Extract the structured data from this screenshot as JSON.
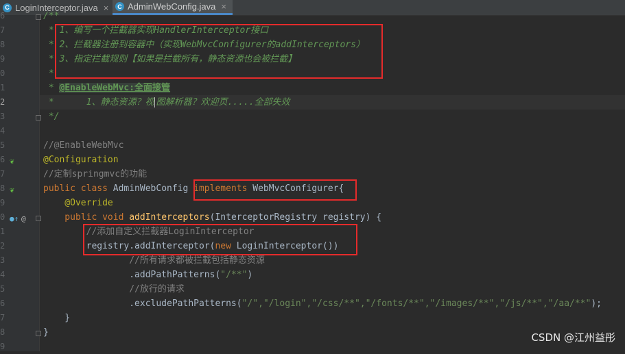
{
  "tabs": [
    {
      "label": "LoginInterceptor.java",
      "active": false
    },
    {
      "label": "AdminWebConfig.java",
      "active": true
    }
  ],
  "line_numbers": [
    "6",
    "7",
    "8",
    "9",
    "0",
    "1",
    "2",
    "3",
    "4",
    "5",
    "6",
    "7",
    "8",
    "9",
    "0",
    "1",
    "2",
    "3",
    "4",
    "5",
    "6",
    "7",
    "8",
    "9"
  ],
  "code": {
    "l0": "/**",
    "l1": " * 1、编写一个拦截器实现HandlerInterceptor接口",
    "l2": " * 2、拦截器注册到容器中（实现WebMvcConfigurer的addInterceptors）",
    "l3": " * 3、指定拦截规则【如果是拦截所有，静态资源也会被拦截】",
    "l4": " *",
    "l5_prefix": " * ",
    "l5_tag": "@EnableWebMvc:全面接管",
    "l6_a": " *      1、静态资源？视",
    "l6_b": "图解析器？欢迎页.....全部失效",
    "l7": " */",
    "l9": "//@EnableWebMvc",
    "l10": "@Configuration",
    "l11": "//定制springmvc的功能",
    "l12_kw": "public class ",
    "l12_name": "AdminWebConfig ",
    "l12_impl": "implements",
    "l12_iface": " WebMvcConfigurer{",
    "l13": "    @Override",
    "l14_kw": "    public void ",
    "l14_fn": "addInterceptors",
    "l14_rest": "(InterceptorRegistry registry) {",
    "l15": "        //添加自定义拦截器LoginInterceptor",
    "l16_a": "        registry.addInterceptor(",
    "l16_new": "new",
    "l16_b": " LoginInterceptor())",
    "l17": "                //所有请求都被拦截包括静态资源",
    "l18_a": "                .addPathPatterns(",
    "l18_s": "\"/**\"",
    "l18_b": ")",
    "l19": "                //放行的请求",
    "l20_a": "                .excludePathPatterns(",
    "l20_s": "\"/\",\"/login\",\"/css/**\",\"/fonts/**\",\"/images/**\",\"/js/**\",\"/aa/**\"",
    "l20_b": ");",
    "l21": "    }",
    "l22": "}"
  },
  "watermark": "CSDN @江州益彤",
  "icons": [
    "java-class-icon",
    "bean-icon",
    "override-icon",
    "annotation-icon"
  ],
  "colors": {
    "keyword": "#cc7832",
    "comment": "#629755",
    "annotation": "#bbb529",
    "function": "#ffc66d",
    "string": "#6a8759",
    "highlight_box": "#e52b2b"
  }
}
